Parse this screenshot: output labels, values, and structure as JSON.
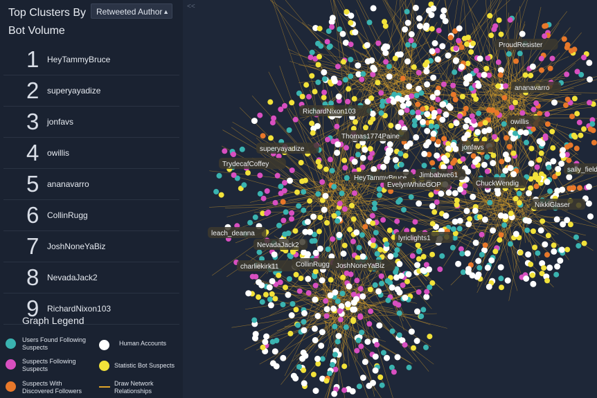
{
  "sidebar": {
    "title": "Top Clusters By Bot Volume",
    "selector_value": "Retweeted Author",
    "clusters": [
      {
        "rank": "1",
        "name": "HeyTammyBruce"
      },
      {
        "rank": "2",
        "name": "superyayadize"
      },
      {
        "rank": "3",
        "name": "jonfavs"
      },
      {
        "rank": "4",
        "name": "owillis"
      },
      {
        "rank": "5",
        "name": "ananavarro"
      },
      {
        "rank": "6",
        "name": "CollinRugg"
      },
      {
        "rank": "7",
        "name": "JoshNoneYaBiz"
      },
      {
        "rank": "8",
        "name": "NevadaJack2"
      },
      {
        "rank": "9",
        "name": "RichardNixon103"
      }
    ]
  },
  "collapse_label": "<<",
  "legend": {
    "title": "Graph Legend",
    "items": {
      "users_following": {
        "label": "Users Found Following Suspects",
        "color": "#3ab3b0"
      },
      "suspects_following": {
        "label": "Suspects Following Suspects",
        "color": "#d84fc0"
      },
      "suspects_followers": {
        "label": "Suspects With Discovered Followers",
        "color": "#e8782a"
      },
      "human": {
        "label": "Human Accounts",
        "color": "#ffffff"
      },
      "bot": {
        "label": "Statistic Bot Suspects",
        "color": "#f2e23a"
      },
      "relationships": {
        "label": "Draw Network Relationships",
        "color": "#e0a52a"
      }
    }
  },
  "graph": {
    "labels": [
      "ProudResister",
      "ananavarro",
      "RichardNixon103",
      "owillis",
      "Thomas1774Paine",
      "superyayadize",
      "jonfavs",
      "TrydecafCoffey",
      "Jimbabwe61",
      "sally_field",
      "HeyTammyBruce",
      "EvelynWhiteGOP",
      "ChuckWendig",
      "NikkiGlaser",
      "leach_deanna",
      "NevadaJack2",
      "lyriclights1",
      "charliekirk11",
      "CollinRugg",
      "JoshNoneYaBiz"
    ]
  }
}
